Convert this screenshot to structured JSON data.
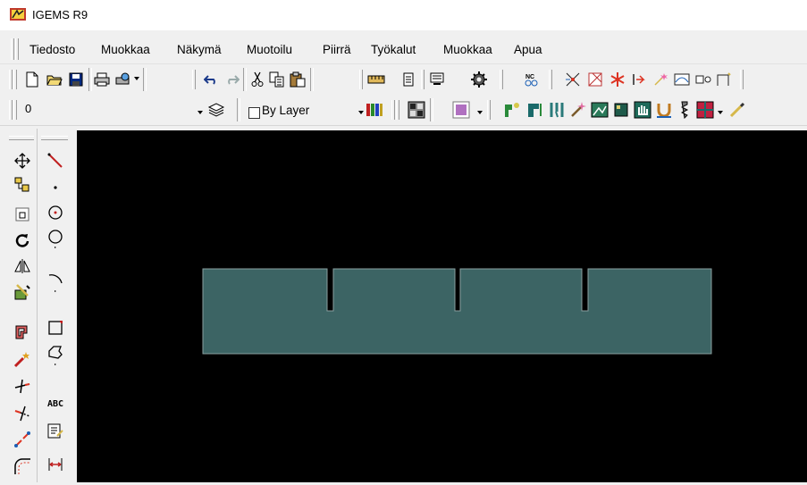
{
  "window": {
    "title": "IGEMS R9",
    "app_icon": "igems-logo-icon"
  },
  "menu": {
    "items": [
      "Tiedosto",
      "Muokkaa",
      "Näkymä",
      "Muotoilu",
      "Piirrä",
      "Työkalut",
      "Muokkaa",
      "Apua"
    ]
  },
  "toolbar1": {
    "icons": [
      "new-file-icon",
      "open-folder-icon",
      "save-icon",
      "print-icon",
      "plot-icon",
      "undo-icon",
      "redo-icon",
      "cut-icon",
      "copy-icon",
      "paste-icon",
      "measure-ruler-icon",
      "notes-icon",
      "monitor-icon",
      "settings-gear-icon",
      "nc-icon",
      "snap-cross-icon",
      "snap-box-icon",
      "snap-asterisk-icon",
      "snap-arrow-icon",
      "snap-sparkle-icon",
      "snap-curve-icon",
      "snap-node-icon",
      "snap-corner-icon"
    ]
  },
  "toolbar2": {
    "layer_value": "0",
    "linetype_label": "By Layer",
    "icons": [
      "layers-icon",
      "color-bars-icon",
      "pattern-icon",
      "color-swatch-icon",
      "tool-path-icon",
      "tool-path2-icon",
      "tools-icon",
      "wand-icon",
      "image-icon",
      "box-icon",
      "hand-icon",
      "magnet-icon",
      "drill-icon",
      "grid-icon",
      "pencil-icon"
    ]
  },
  "palette": {
    "left_icons": [
      "move-icon",
      "copy-elements-icon",
      "scale-icon",
      "rotate-icon",
      "mirror-icon",
      "array-icon",
      "offset-icon",
      "explode-icon",
      "trim-icon",
      "extend-icon",
      "break-icon",
      "fillet-icon"
    ],
    "right_icons": [
      "line-icon",
      "point-icon",
      "circle-center-icon",
      "circle-icon",
      "arc-icon",
      "rectangle-icon",
      "polygon-icon",
      "text-abc-icon",
      "text-edit-icon",
      "dimension-icon"
    ],
    "text_icon_label": "ABC"
  },
  "colors": {
    "canvas": "#000000",
    "part_fill": "#3c6464",
    "part_stroke": "#8a9fa0"
  }
}
